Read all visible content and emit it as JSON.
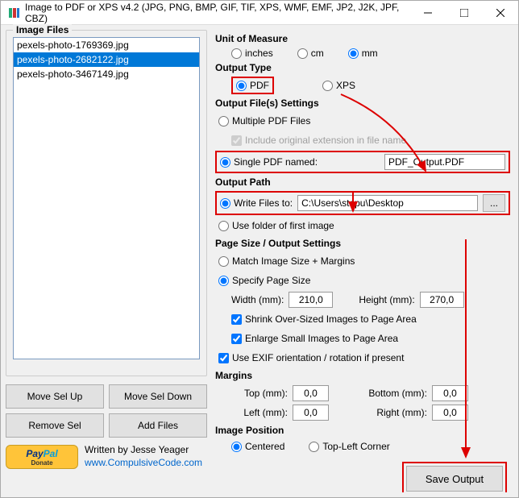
{
  "window": {
    "title": "Image to PDF or XPS  v4.2    (JPG, PNG, BMP, GIF, TIF, XPS, WMF, EMF, JP2, J2K, JPF, CBZ)"
  },
  "left": {
    "group_title": "Image Files",
    "files": [
      "pexels-photo-1769369.jpg",
      "pexels-photo-2682122.jpg",
      "pexels-photo-3467149.jpg"
    ],
    "selected_index": 1,
    "btn_up": "Move Sel Up",
    "btn_down": "Move Sel Down",
    "btn_remove": "Remove Sel",
    "btn_add": "Add Files",
    "credit1": "Written by Jesse Yeager",
    "credit2": "www.CompulsiveCode.com"
  },
  "right": {
    "unit": {
      "title": "Unit of Measure",
      "opts": [
        "inches",
        "cm",
        "mm"
      ],
      "selected": "mm"
    },
    "outtype": {
      "title": "Output Type",
      "opts": [
        "PDF",
        "XPS"
      ],
      "selected": "PDF"
    },
    "files": {
      "title": "Output File(s) Settings",
      "multiple": "Multiple PDF Files",
      "include_ext": "Include original extension in file name",
      "single": "Single PDF named:",
      "single_value": "PDF_Output.PDF"
    },
    "path": {
      "title": "Output Path",
      "write": "Write Files to:",
      "write_value": "C:\\Users\\stepu\\Desktop",
      "browse": "...",
      "usefolder": "Use folder of first image"
    },
    "page": {
      "title": "Page Size / Output Settings",
      "match": "Match Image Size + Margins",
      "specify": "Specify Page Size",
      "width_label": "Width (mm):",
      "width_value": "210,0",
      "height_label": "Height (mm):",
      "height_value": "270,0",
      "shrink": "Shrink Over-Sized Images to Page Area",
      "enlarge": "Enlarge Small Images to Page Area",
      "exif": "Use EXIF orientation / rotation if present"
    },
    "margins": {
      "title": "Margins",
      "top": "Top (mm):",
      "top_v": "0,0",
      "bottom": "Bottom (mm):",
      "bottom_v": "0,0",
      "left": "Left (mm):",
      "left_v": "0,0",
      "right": "Right (mm):",
      "right_v": "0,0"
    },
    "imgpos": {
      "title": "Image Position",
      "opts": [
        "Centered",
        "Top-Left Corner"
      ],
      "selected": "Centered"
    },
    "save": "Save Output"
  }
}
